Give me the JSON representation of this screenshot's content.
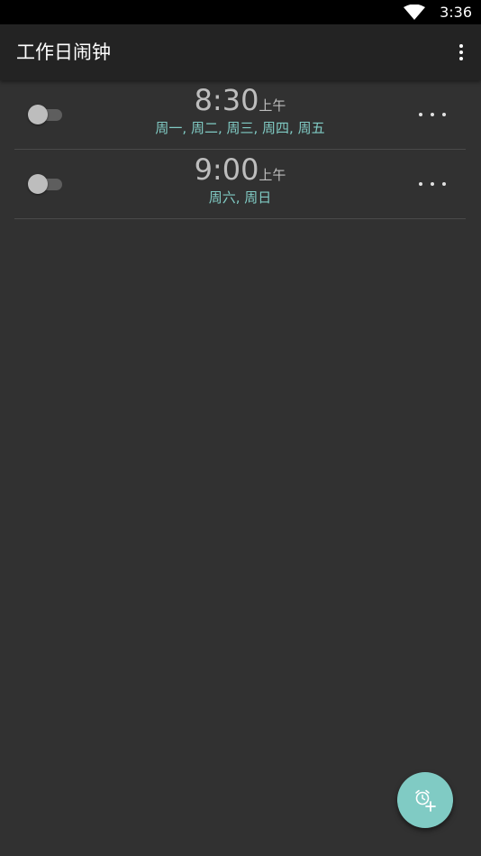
{
  "status_bar": {
    "time": "3:36",
    "wifi_icon": "wifi-icon"
  },
  "app_bar": {
    "title": "工作日闹钟",
    "overflow_icon": "more-vert-icon"
  },
  "alarms": [
    {
      "time": "8:30",
      "ampm": "上午",
      "days": "周一, 周二, 周三, 周四, 周五",
      "enabled": false,
      "more_icon": "more-horiz-icon"
    },
    {
      "time": "9:00",
      "ampm": "上午",
      "days": "周六, 周日",
      "enabled": false,
      "more_icon": "more-horiz-icon"
    }
  ],
  "fab": {
    "icon": "add-alarm-icon"
  },
  "colors": {
    "background": "#313131",
    "app_bar": "#232323",
    "accent": "#80cbc4",
    "time_text": "#bdbdbd"
  }
}
